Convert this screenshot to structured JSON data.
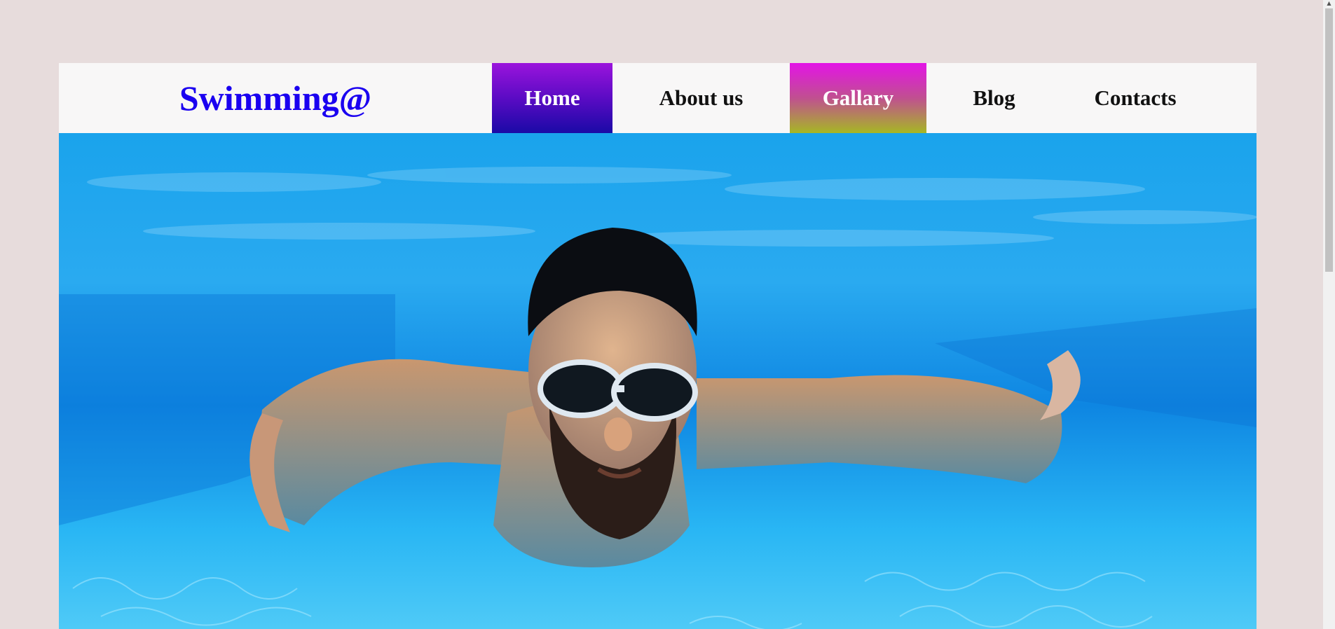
{
  "header": {
    "logo": "Swimming@",
    "nav": [
      {
        "label": "Home"
      },
      {
        "label": "About us"
      },
      {
        "label": "Gallary"
      },
      {
        "label": "Blog"
      },
      {
        "label": "Contacts"
      }
    ]
  },
  "colors": {
    "background": "#e7dcdc",
    "header_bg": "#f8f7f7",
    "logo": "#1a00f0",
    "home_gradient": [
      "#9a14dc",
      "#1a0aa6"
    ],
    "gallary_gradient": [
      "#e314e6",
      "#a6b824"
    ],
    "water": "#13a0ea"
  },
  "icons": {
    "scroll_up": "triangle-up-icon"
  }
}
